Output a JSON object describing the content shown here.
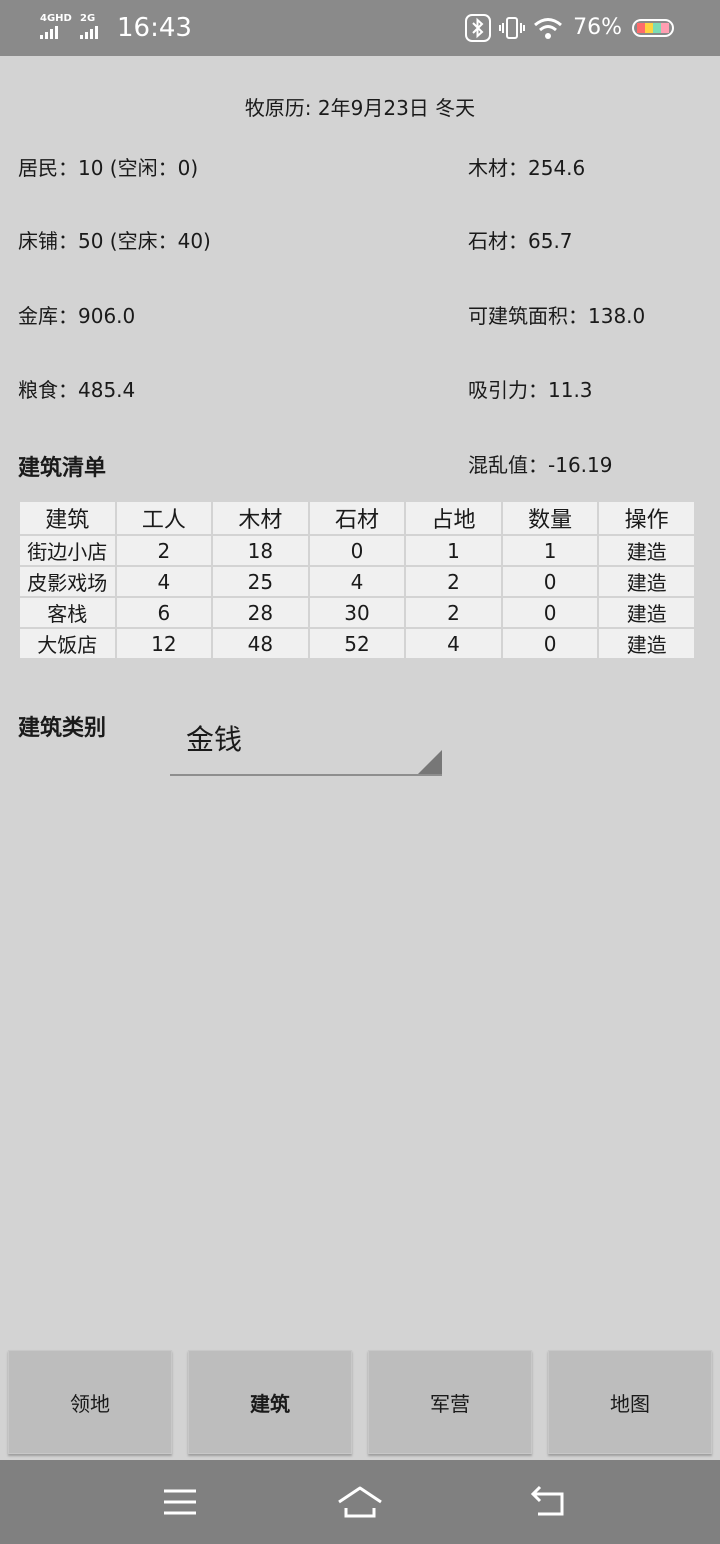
{
  "status_bar": {
    "signal1": "4GHD",
    "signal2": "2G",
    "time": "16:43",
    "battery_percent": "76%",
    "battery_colors": [
      "#ff6b6b",
      "#ffd23f",
      "#7bdcb5",
      "#ff9fb2"
    ]
  },
  "calendar": "牧原历: 2年9月23日  冬天",
  "stats": {
    "residents": "居民：10 (空闲：0)",
    "wood": "木材：254.6",
    "beds": "床铺：50 (空床：40)",
    "stone": "石材：65.7",
    "treasury": "金库：906.0",
    "buildable_area": "可建筑面积：138.0",
    "food": "粮食：485.4",
    "attraction": "吸引力：11.3",
    "chaos": "混乱值：-16.19"
  },
  "building_list": {
    "title": "建筑清单",
    "headers": [
      "建筑",
      "工人",
      "木材",
      "石材",
      "占地",
      "数量",
      "操作"
    ],
    "rows": [
      {
        "name": "街边小店",
        "workers": "2",
        "wood": "18",
        "stone": "0",
        "area": "1",
        "count": "1",
        "action": "建造"
      },
      {
        "name": "皮影戏场",
        "workers": "4",
        "wood": "25",
        "stone": "4",
        "area": "2",
        "count": "0",
        "action": "建造"
      },
      {
        "name": "客栈",
        "workers": "6",
        "wood": "28",
        "stone": "30",
        "area": "2",
        "count": "0",
        "action": "建造"
      },
      {
        "name": "大饭店",
        "workers": "12",
        "wood": "48",
        "stone": "52",
        "area": "4",
        "count": "0",
        "action": "建造"
      }
    ]
  },
  "category": {
    "label": "建筑类别",
    "selected": "金钱"
  },
  "bottom_nav": {
    "territory": "领地",
    "buildings": "建筑",
    "barracks": "军营",
    "map": "地图",
    "active": "建筑"
  },
  "system_nav": {
    "icons": [
      "menu-icon",
      "home-icon",
      "back-icon"
    ]
  }
}
